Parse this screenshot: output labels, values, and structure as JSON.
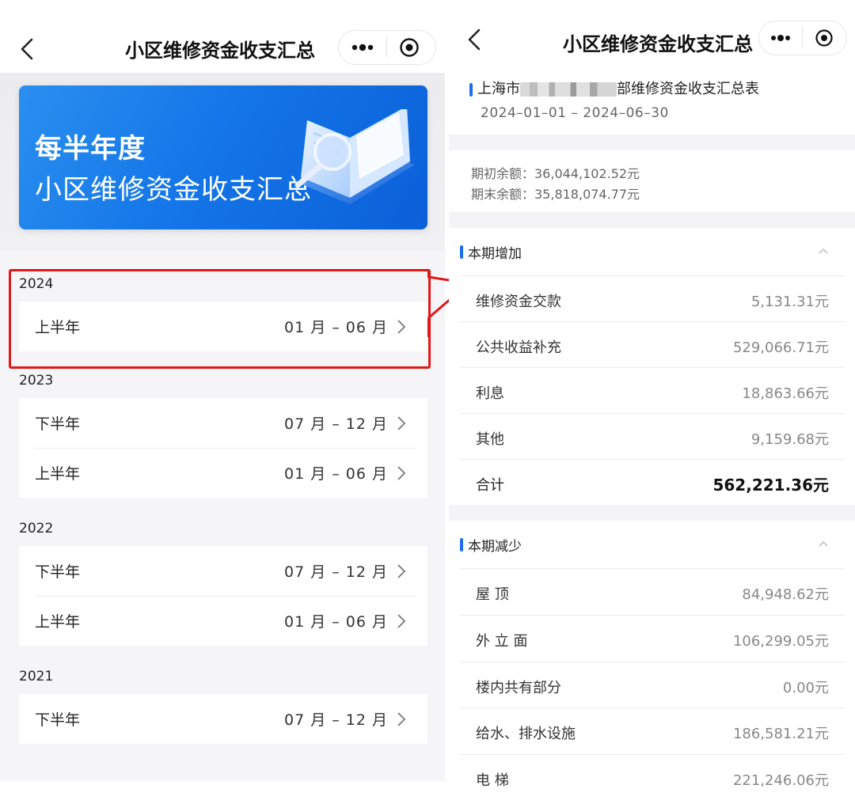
{
  "left": {
    "header": {
      "title": "小区维修资金收支汇总"
    },
    "banner": {
      "line1": "每半年度",
      "line2": "小区维修资金收支汇总"
    },
    "years": [
      {
        "year": "2024",
        "items": [
          {
            "name": "上半年",
            "range": "01 月 – 06 月"
          }
        ]
      },
      {
        "year": "2023",
        "items": [
          {
            "name": "下半年",
            "range": "07 月 – 12 月"
          },
          {
            "name": "上半年",
            "range": "01 月 – 06 月"
          }
        ]
      },
      {
        "year": "2022",
        "items": [
          {
            "name": "下半年",
            "range": "07 月 – 12 月"
          },
          {
            "name": "上半年",
            "range": "01 月 – 06 月"
          }
        ]
      },
      {
        "year": "2021",
        "items": [
          {
            "name": "下半年",
            "range": "07 月 – 12 月"
          }
        ]
      }
    ],
    "colors": {
      "highlight": "#e01818",
      "banner": "#1476e8"
    }
  },
  "right": {
    "header": {
      "title": "小区维修资金收支汇总"
    },
    "report": {
      "title_prefix": "上海市",
      "title_suffix": "部维修资金收支汇总表",
      "range": "2024–01–01 – 2024–06–30"
    },
    "balance": {
      "opening": "期初余额：36,044,102.52元",
      "closing": "期末余额：35,818,074.77元"
    },
    "increase": {
      "label": "本期增加",
      "items": [
        {
          "name": "维修资金交款",
          "value": "5,131.31元"
        },
        {
          "name": "公共收益补充",
          "value": "529,066.71元"
        },
        {
          "name": "利息",
          "value": "18,863.66元"
        },
        {
          "name": "其他",
          "value": "9,159.68元"
        }
      ],
      "total": {
        "name": "合计",
        "value": "562,221.36元"
      }
    },
    "decrease": {
      "label": "本期减少",
      "items": [
        {
          "name": "屋 顶",
          "value": "84,948.62元"
        },
        {
          "name": "外 立 面",
          "value": "106,299.05元"
        },
        {
          "name": "楼内共有部分",
          "value": "0.00元"
        },
        {
          "name": "给水、排水设施",
          "value": "186,581.21元"
        },
        {
          "name": "电 梯",
          "value": "221,246.06元"
        }
      ]
    },
    "colors": {
      "accent_bar": "#1e6cf0"
    }
  }
}
